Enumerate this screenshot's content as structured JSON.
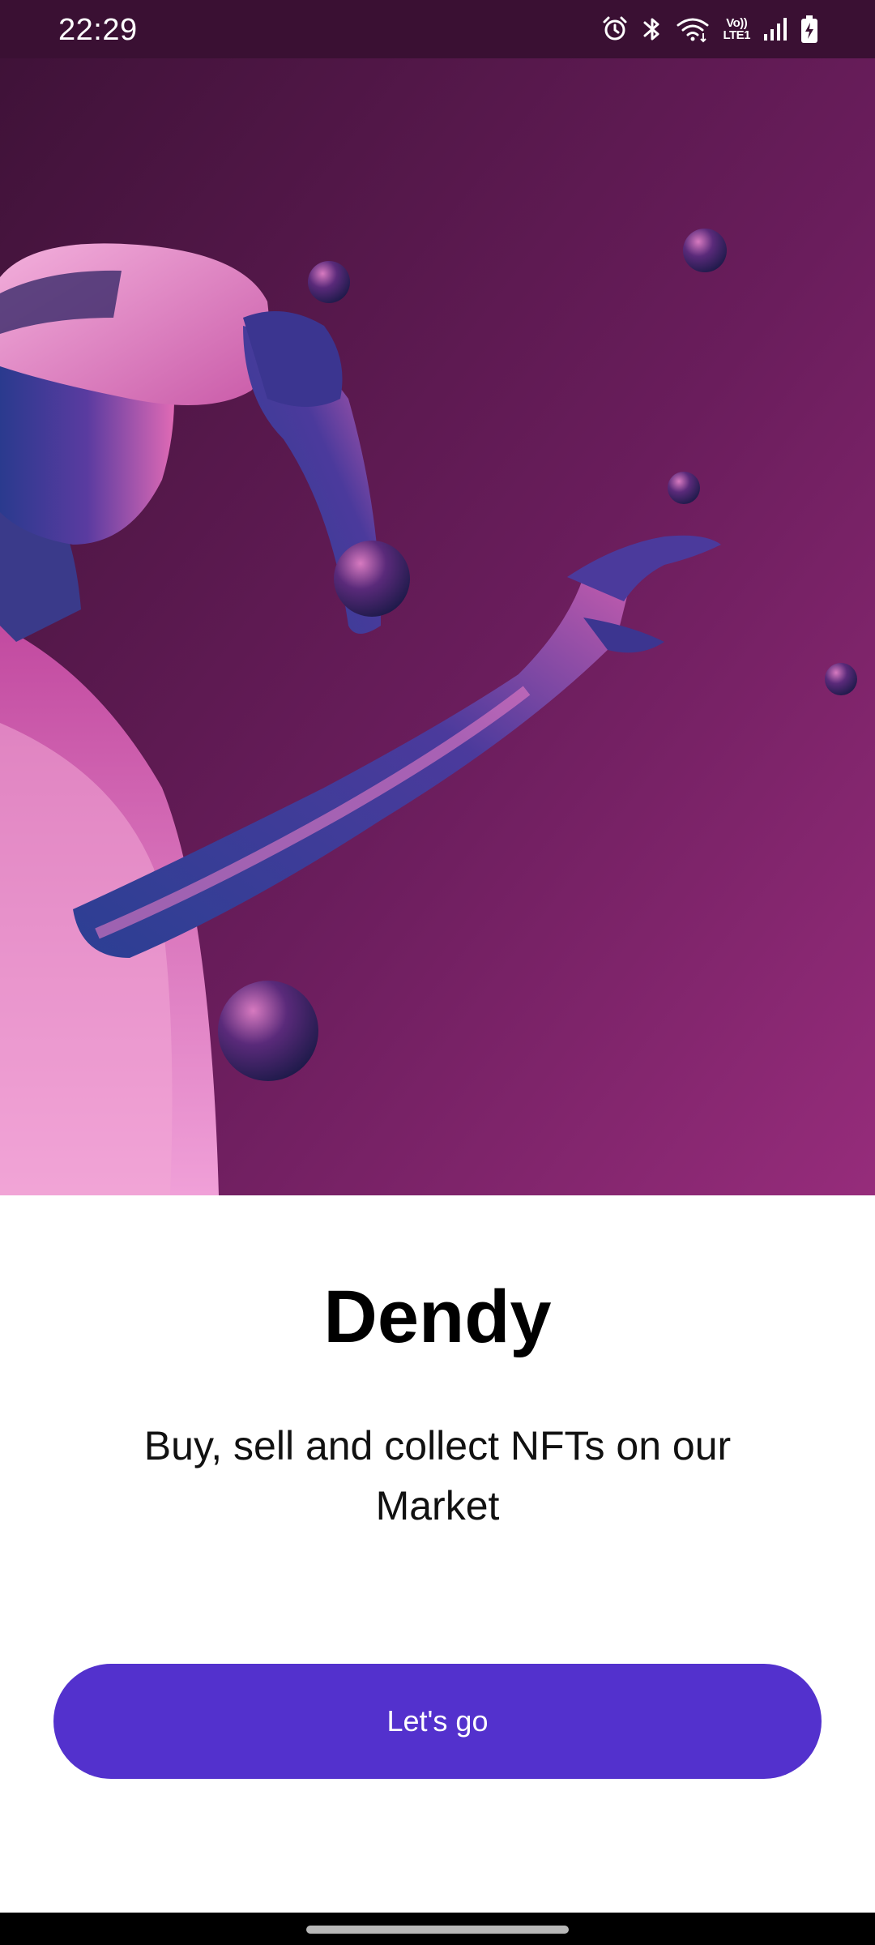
{
  "status_bar": {
    "time": "22:29",
    "icons": [
      "alarm-icon",
      "bluetooth-icon",
      "wifi-icon",
      "volte-icon",
      "signal-icon",
      "battery-charging-icon"
    ],
    "volte_label_top": "Vo))",
    "volte_label_bottom": "LTE1"
  },
  "hero": {
    "image": "vr-headset-figure-illustration",
    "colors": {
      "background_top": "#4a1440",
      "background_bottom": "#8e2a75",
      "figure_pink": "#e46ab8",
      "figure_blue": "#2b3a8c"
    }
  },
  "main": {
    "title": "Dendy",
    "tagline": "Buy, sell and collect NFTs on our Market",
    "cta_label": "Let's go"
  },
  "colors": {
    "accent": "#5331cd",
    "status_bar": "#3a1033",
    "nav_bar": "#000000"
  }
}
